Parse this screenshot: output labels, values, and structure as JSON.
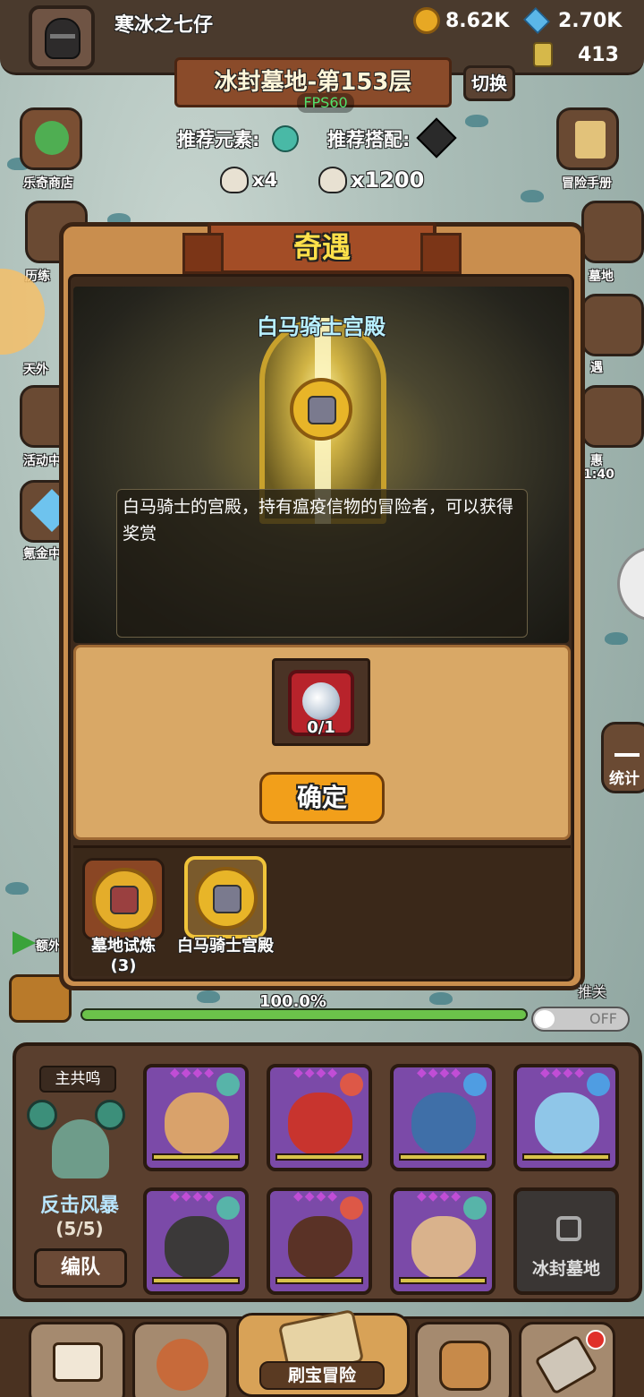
{
  "header": {
    "player_name": "寒冰之七仔",
    "gold": "8.62K",
    "gems": "2.70K",
    "energy": "413"
  },
  "stage": {
    "title": "冰封墓地-第153层",
    "switch_label": "切换",
    "fps": "FPS60",
    "recommend_element_label": "推荐元素:",
    "recommend_combo_label": "推荐搭配:",
    "skull_small": "x4",
    "skull_large": "x1200"
  },
  "side_left": [
    {
      "label": "乐奇商店"
    },
    {
      "label": "历练"
    },
    {
      "label": "天外"
    },
    {
      "label": "活动中"
    },
    {
      "label": "氪金中"
    }
  ],
  "side_right": [
    {
      "label": "冒险手册"
    },
    {
      "label": "墓地"
    },
    {
      "label": "遇"
    },
    {
      "label": "惠"
    },
    {
      "label": "统计"
    }
  ],
  "side_right_timer": "1:40",
  "left_extra": "额外",
  "modal": {
    "ribbon_title": "奇遇",
    "event_title": "白马骑士宫殿",
    "description": "白马骑士的宫殿，持有瘟疫信物的冒险者，可以获得奖赏",
    "item_count": "0/1",
    "confirm_label": "确定",
    "tabs": [
      {
        "label": "墓地试炼(3)"
      },
      {
        "label": "白马骑士宫殿"
      }
    ]
  },
  "progress": {
    "percent_text": "100.0%",
    "value": 1.0,
    "toggle_state": "OFF",
    "toggle_caption": "推关"
  },
  "team": {
    "resonance_label": "主共鸣",
    "skill_name": "反击风暴",
    "skill_count": "(5/5)",
    "formation_label": "编队",
    "locked_slot": "冰封墓地"
  },
  "bottom_nav": {
    "center_label": "刷宝冒险"
  },
  "colors": {
    "wood": "#c98e4e",
    "accent_orange": "#f29f1a",
    "title_yellow": "#ffe14a",
    "event_cyan": "#b8f0ff",
    "hero_purple": "#7b4aa8",
    "fps_green": "#52e06c"
  }
}
